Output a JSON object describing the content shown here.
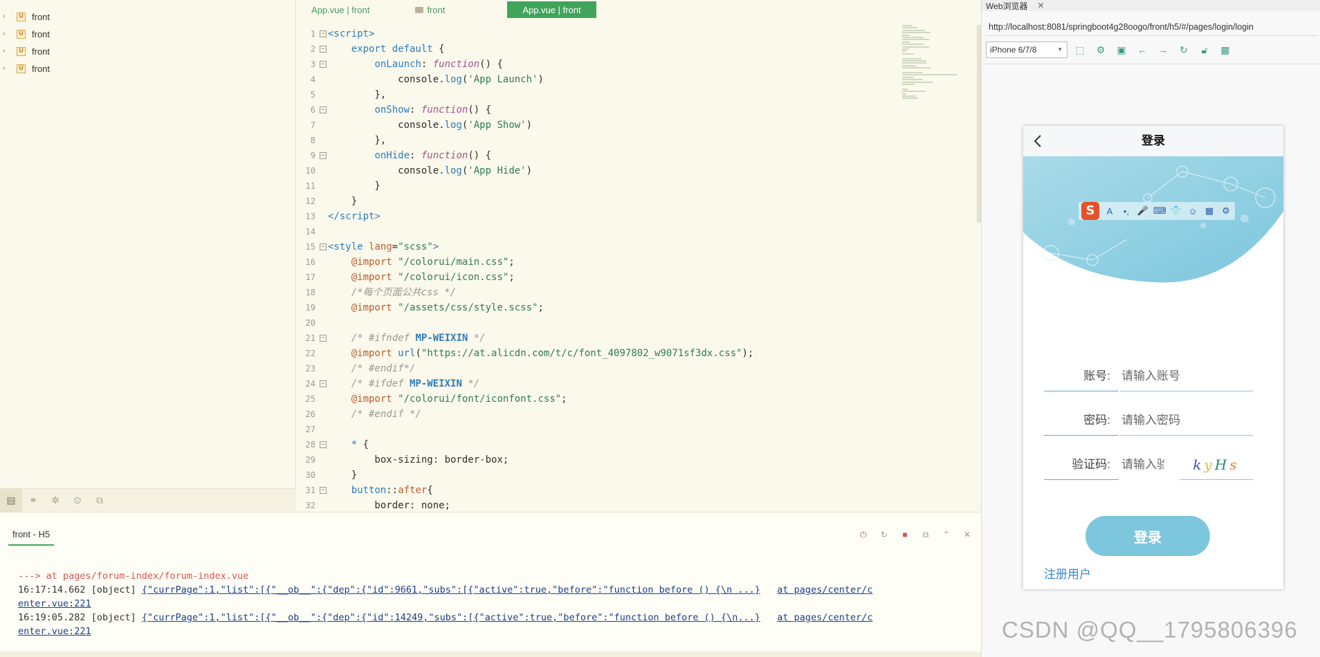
{
  "explorer": {
    "projects": [
      {
        "name": "front"
      },
      {
        "name": "front"
      },
      {
        "name": "front"
      },
      {
        "name": "front"
      }
    ],
    "bottom_tabs": [
      "project-tab",
      "plugins-tab",
      "debug-tab",
      "search-tab",
      "history-tab"
    ]
  },
  "editor": {
    "tabs": [
      {
        "label": "App.vue | front",
        "icon": "none"
      },
      {
        "label": "front",
        "icon": "folder-icon"
      },
      {
        "label": "App.vue | front",
        "icon": "none",
        "active": true
      }
    ],
    "lines": [
      {
        "n": "1",
        "fold": true,
        "html": "<span class='k'>&lt;script&gt;</span>"
      },
      {
        "n": "2",
        "fold": true,
        "html": "    <span class='k'>export default</span> {"
      },
      {
        "n": "3",
        "fold": true,
        "html": "        <span class='k'>onLaunch</span>: <span class='f'>function</span>() {"
      },
      {
        "n": "4",
        "fold": false,
        "html": "            console.<span class='k'>log</span>(<span class='s'>'App Launch'</span>)"
      },
      {
        "n": "5",
        "fold": false,
        "html": "        },"
      },
      {
        "n": "6",
        "fold": true,
        "html": "        <span class='k'>onShow</span>: <span class='f'>function</span>() {"
      },
      {
        "n": "7",
        "fold": false,
        "html": "            console.<span class='k'>log</span>(<span class='s'>'App Show'</span>)"
      },
      {
        "n": "8",
        "fold": false,
        "html": "        },"
      },
      {
        "n": "9",
        "fold": true,
        "html": "        <span class='k'>onHide</span>: <span class='f'>function</span>() {"
      },
      {
        "n": "10",
        "fold": false,
        "html": "            console.<span class='k'>log</span>(<span class='s'>'App Hide'</span>)"
      },
      {
        "n": "11",
        "fold": false,
        "html": "        }"
      },
      {
        "n": "12",
        "fold": false,
        "html": "    }"
      },
      {
        "n": "13",
        "fold": false,
        "html": "<span class='k'>&lt;/script&gt;</span>"
      },
      {
        "n": "14",
        "fold": false,
        "html": ""
      },
      {
        "n": "15",
        "fold": true,
        "html": "<span class='k'>&lt;style</span> <span class='p'>lang</span>=<span class='s'>\"scss\"</span><span class='k'>&gt;</span>"
      },
      {
        "n": "16",
        "fold": false,
        "html": "    <span class='p'>@import</span> <span class='s'>\"/colorui/main.css\"</span>;"
      },
      {
        "n": "17",
        "fold": false,
        "html": "    <span class='p'>@import</span> <span class='s'>\"/colorui/icon.css\"</span>;"
      },
      {
        "n": "18",
        "fold": false,
        "html": "    <span class='c'>/*每个页面公共css */</span>"
      },
      {
        "n": "19",
        "fold": false,
        "html": "    <span class='p'>@import</span> <span class='s'>\"/assets/css/style.scss\"</span>;"
      },
      {
        "n": "20",
        "fold": false,
        "html": ""
      },
      {
        "n": "21",
        "fold": true,
        "html": "    <span class='c'>/* #ifndef </span><span class='b'>MP-WEIXIN</span><span class='c'> */</span>"
      },
      {
        "n": "22",
        "fold": false,
        "html": "    <span class='p'>@import</span> <span class='k'>url</span>(<span class='s'>\"https://at.alicdn.com/t/c/font_4097802_w9071sf3dx.css\"</span>);"
      },
      {
        "n": "23",
        "fold": false,
        "html": "    <span class='c'>/* #endif*/</span>"
      },
      {
        "n": "24",
        "fold": true,
        "html": "    <span class='c'>/* #ifdef </span><span class='b'>MP-WEIXIN</span><span class='c'> */</span>"
      },
      {
        "n": "25",
        "fold": false,
        "html": "    <span class='p'>@import</span> <span class='s'>\"/colorui/font/iconfont.css\"</span>;"
      },
      {
        "n": "26",
        "fold": false,
        "html": "    <span class='c'>/* #endif */</span>"
      },
      {
        "n": "27",
        "fold": false,
        "html": ""
      },
      {
        "n": "28",
        "fold": true,
        "html": "    <span class='k'>*</span> {"
      },
      {
        "n": "29",
        "fold": false,
        "html": "        box-sizing: border-box;"
      },
      {
        "n": "30",
        "fold": false,
        "html": "    }"
      },
      {
        "n": "31",
        "fold": true,
        "html": "    <span class='k'>button</span>::<span class='p'>after</span>{"
      },
      {
        "n": "32",
        "fold": false,
        "html": "        border: none;"
      }
    ]
  },
  "console": {
    "tab_label": "front - H5",
    "actions": [
      "stop-icon",
      "restart-icon",
      "clear-icon",
      "copy-icon",
      "collapse-icon",
      "close-icon"
    ],
    "arrow_line": "---> at pages/forum-index/forum-index.vue",
    "logs": [
      {
        "time": "16:17:14.662",
        "type": "[object]",
        "json": "{\"currPage\":1,\"list\":[{\"__ob__\":{\"dep\":{\"id\":9661,\"subs\":[{\"active\":true,\"before\":\"function before () {\\n ...}",
        "at_prefix": "at pages/center/c",
        "at_suffix": "enter.vue:221"
      },
      {
        "time": "16:19:05.282",
        "type": "[object]",
        "json": "{\"currPage\":1,\"list\":[{\"__ob__\":{\"dep\":{\"id\":14249,\"subs\":[{\"active\":true,\"before\":\"function before () {\\n...}",
        "at_prefix": "at pages/center/c",
        "at_suffix": "enter.vue:221"
      }
    ]
  },
  "browser": {
    "tab_title": "Web浏览器",
    "tab_close": "✕",
    "url": "http://localhost:8081/springboot4g28oogo/front/h5/#/pages/login/login",
    "device": "iPhone 6/7/8",
    "toolbar_icons": [
      "screenshot-icon",
      "settings-icon",
      "console-icon",
      "back-icon",
      "forward-icon",
      "refresh-icon",
      "lock-icon",
      "qrcode-icon"
    ],
    "phone": {
      "nav_title": "登录",
      "fields": [
        {
          "label": "账号:",
          "placeholder": "请输入账号"
        },
        {
          "label": "密码:",
          "placeholder": "请输入密码"
        },
        {
          "label": "验证码:",
          "placeholder": "请输入验证码"
        }
      ],
      "captcha": [
        {
          "ch": "k",
          "color": "#3e4fa0"
        },
        {
          "ch": "y",
          "color": "#e0b93a"
        },
        {
          "ch": "H",
          "color": "#2a8a6c"
        },
        {
          "ch": "s",
          "color": "#d98a3a"
        }
      ],
      "login_button": "登录",
      "register_link": "注册用户",
      "ime_toolbar": {
        "logo": "S",
        "items": [
          "A",
          "•,",
          "🎤",
          "⌨",
          "👕",
          "☺",
          "▦",
          "⚙"
        ]
      }
    }
  },
  "watermark": "CSDN @QQ__1795806396",
  "colors": {
    "accent_green": "#41a45b",
    "button_blue": "#7cc6de",
    "link_blue": "#3a86c8",
    "editor_bg": "#fbf9ec"
  }
}
